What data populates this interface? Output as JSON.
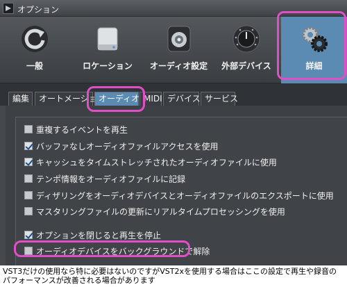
{
  "window": {
    "title": "オプション"
  },
  "toolbar": {
    "items": [
      {
        "label": "一般",
        "icon": "refresh-icon"
      },
      {
        "label": "ロケーション",
        "icon": "drive-icon"
      },
      {
        "label": "オーディオ設定",
        "icon": "speaker-icon"
      },
      {
        "label": "外部デバイス",
        "icon": "knob-icon"
      },
      {
        "label": "詳細",
        "icon": "gears-icon",
        "active": true
      }
    ]
  },
  "tabs": [
    {
      "label": "編集"
    },
    {
      "label": "オートメーション"
    },
    {
      "label": "オーディオ",
      "active": true
    },
    {
      "label": "MIDI"
    },
    {
      "label": "デバイス"
    },
    {
      "label": "サービス"
    }
  ],
  "options": [
    {
      "label": "重複するイベントを再生",
      "checked": false
    },
    {
      "label": "バッファなしオーディオファイルアクセスを使用",
      "checked": true
    },
    {
      "label": "キャッシュをタイムストレッチされたオーディオファイルに使用",
      "checked": true
    },
    {
      "label": "テンポ情報をオーディオファイルに記録",
      "checked": false
    },
    {
      "label": "ディザリングをオーディオデバイスとオーディオファイルのエクスポートに使用",
      "checked": false
    },
    {
      "label": "マスタリングファイルの更新にリアルタイムプロセッシングを使用",
      "checked": false
    },
    {
      "label": "オプションを閉じると再生を停止",
      "checked": true
    },
    {
      "label": "オーディオデバイスをバックグラウンドで解除",
      "checked": false
    }
  ],
  "note": {
    "line1": "VST3だけの使用なら特に必要はないのですがVST2xを使用する場合はここの設定で再生や録音の",
    "line2": "パフォーマンスが改善される場合があります"
  },
  "colors": {
    "accent": "#5b8bb3",
    "highlight": "#e04ec8"
  }
}
